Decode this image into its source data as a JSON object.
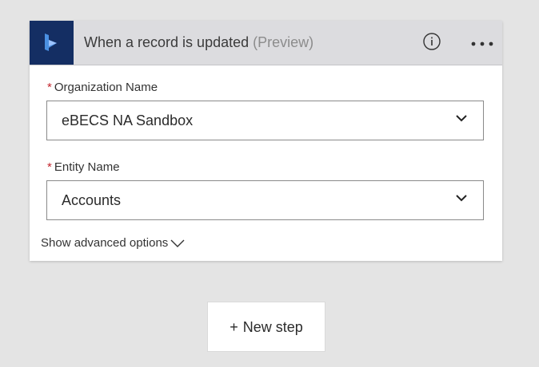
{
  "trigger": {
    "title": "When a record is updated",
    "title_suffix": "(Preview)",
    "connector_icon": "dynamics-icon",
    "connector_color": "#142e63",
    "info_icon": "info-icon",
    "more_icon": "more-icon"
  },
  "fields": [
    {
      "required_mark": "*",
      "label": "Organization Name",
      "value": "eBECS NA Sandbox"
    },
    {
      "required_mark": "*",
      "label": "Entity Name",
      "value": "Accounts"
    }
  ],
  "advanced_options": {
    "label": "Show advanced options"
  },
  "new_step": {
    "plus": "+",
    "label": "New step"
  },
  "colors": {
    "required": "#c4262e",
    "header_bg": "#dcdcdf",
    "page_bg": "#e4e4e4"
  }
}
